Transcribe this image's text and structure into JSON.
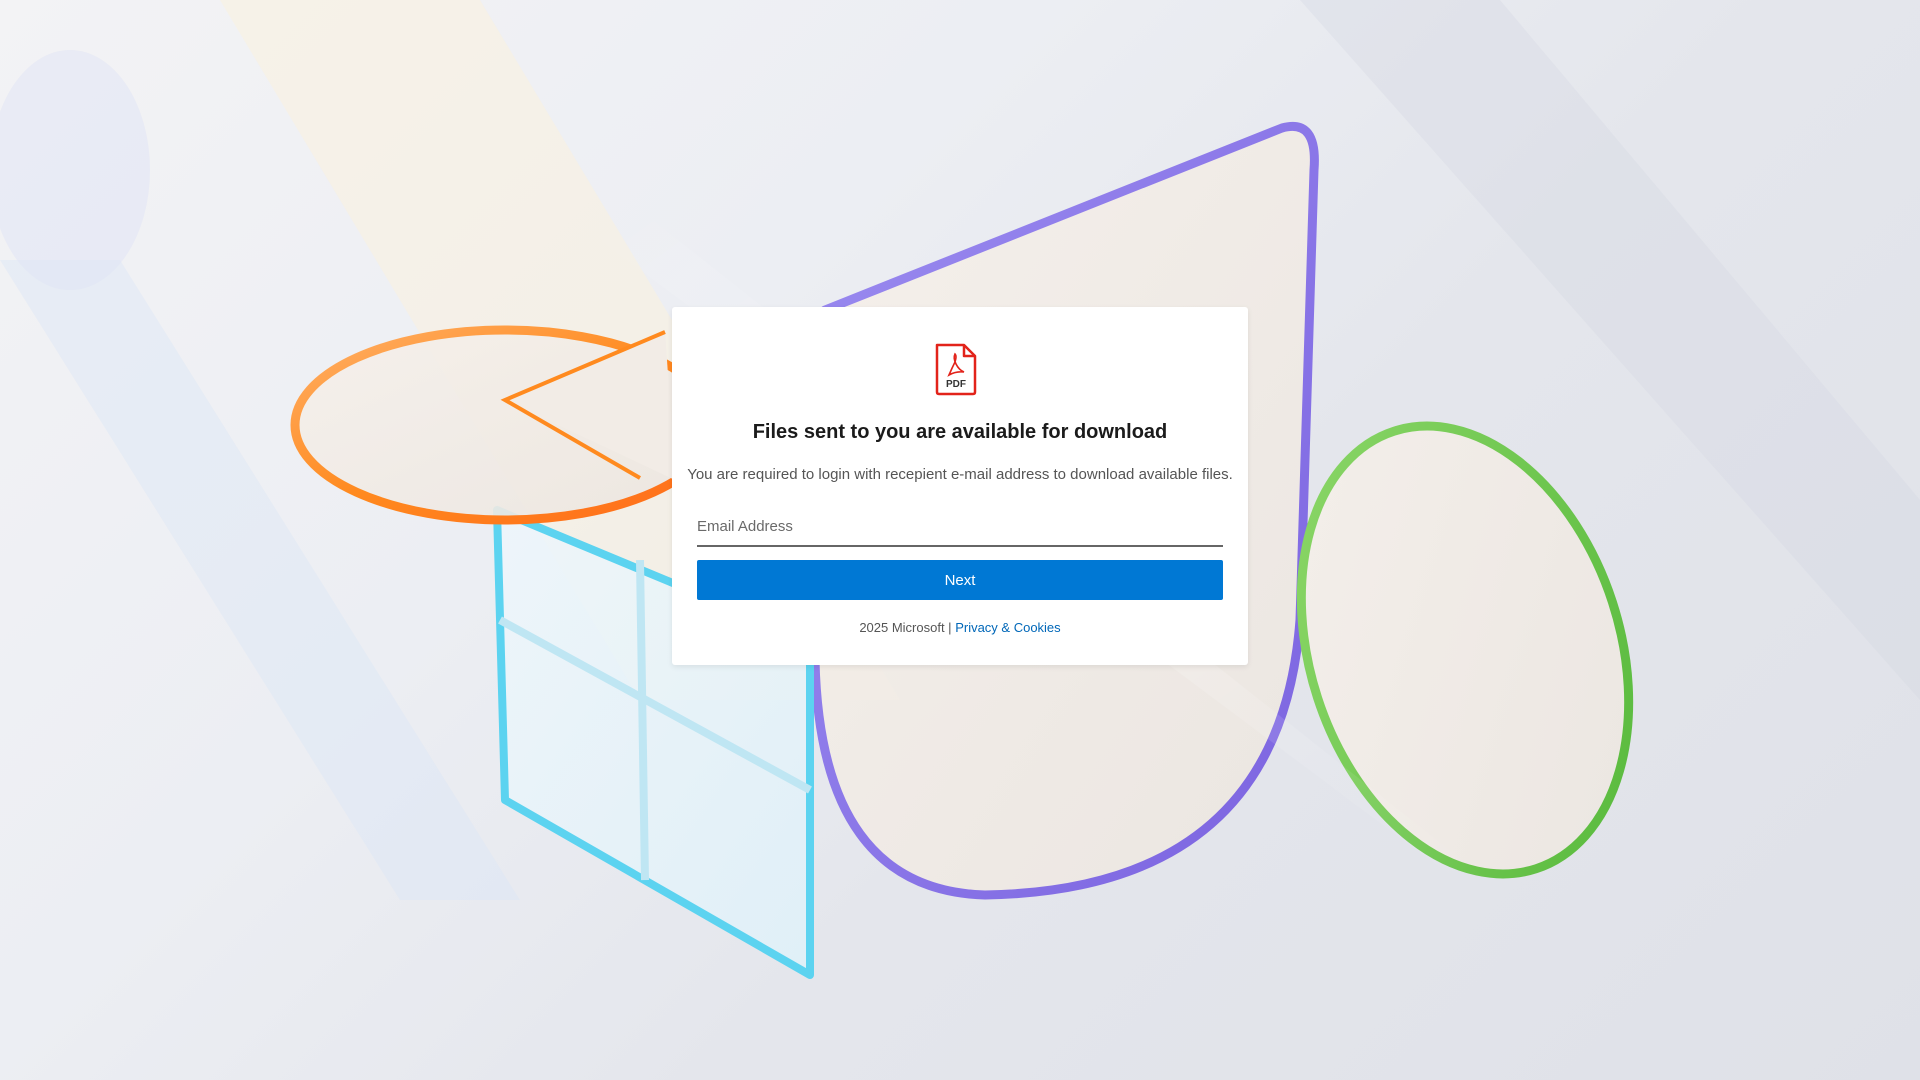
{
  "card": {
    "icon": "pdf-file-icon",
    "icon_label": "PDF",
    "title": "Files sent to you are available for download",
    "subtitle": "You are required to login with recepient e-mail address to download available files.",
    "email_placeholder": "Email Address",
    "email_value": "",
    "next_label": "Next",
    "footer_text": "2025 Microsoft | ",
    "footer_link": "Privacy & Cookies"
  },
  "colors": {
    "accent": "#0078d4",
    "link": "#0067b8",
    "pdf_red": "#e2231a"
  }
}
